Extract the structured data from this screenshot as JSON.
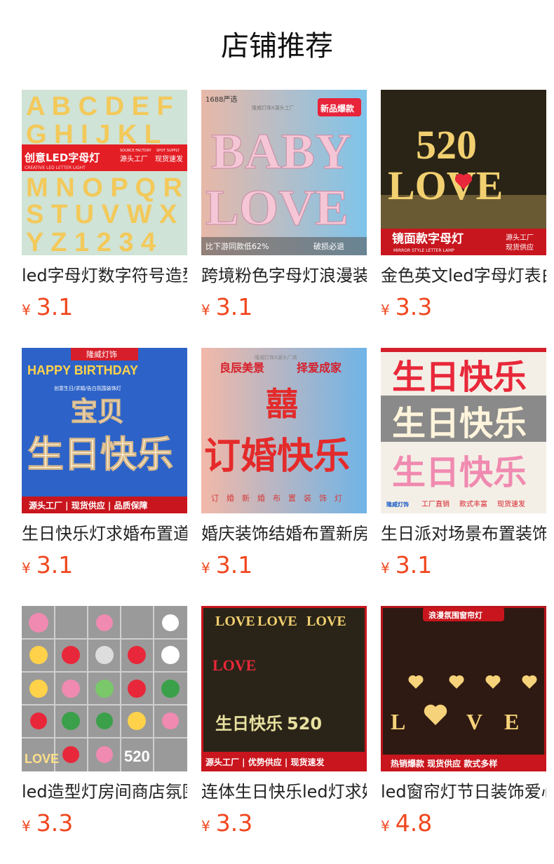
{
  "page_title": "店铺推荐",
  "currency_symbol": "¥",
  "colors": {
    "price": "#f0471f"
  },
  "products": [
    {
      "name": "led字母灯数字符号造型灯",
      "price": "3.1",
      "image_text": [
        "创意LED字母灯",
        "SOURCE FACTORY",
        "SPOT SUPPLY",
        "源头工厂",
        "现货速发",
        "CREATIVE LED LETTER LIGHT"
      ]
    },
    {
      "name": "跨境粉色字母灯浪漫装饰",
      "price": "3.1",
      "image_text": [
        "1688严选",
        "隆威灯饰X源头工厂",
        "新品爆款",
        "BABY",
        "LOVE",
        "比下游同款低62%",
        "破损必退"
      ]
    },
    {
      "name": "金色英文led字母灯表白",
      "price": "3.3",
      "image_text": [
        "520",
        "LOVE",
        "镜面款字母灯",
        "MIRROR STYLE LETTER LAMP",
        "源头工厂",
        "现货供应"
      ]
    },
    {
      "name": "生日快乐灯求婚布置道具",
      "price": "3.1",
      "image_text": [
        "隆威灯饰",
        "HAPPY BIRTHDAY",
        "创意生日/求婚/告白氛围装饰灯",
        "宝贝",
        "生日快乐",
        "源头工厂 | 现货供应 | 品质保障"
      ]
    },
    {
      "name": "婚庆装饰结婚布置新房",
      "price": "3.1",
      "image_text": [
        "隆威灯饰X源头厂商",
        "良辰美景",
        "择爱成家",
        "囍",
        "订婚快乐",
        "订婚新婚布置装饰灯"
      ]
    },
    {
      "name": "生日派对场景布置装饰",
      "price": "3.1",
      "image_text": [
        "生日快乐",
        "生日快乐",
        "生日快乐",
        "隆威灯饰",
        "工厂直销",
        "款式丰富",
        "现货速发"
      ]
    },
    {
      "name": "led造型灯房间商店氛围灯",
      "price": "3.3",
      "image_text": [
        "LOVE",
        "520"
      ]
    },
    {
      "name": "连体生日快乐led灯求婚",
      "price": "3.3",
      "image_text": [
        "LOVE",
        "LOVE",
        "LOVE",
        "LOVE",
        "生日快乐",
        "520",
        "源头工厂 | 优势供应 | 现货速发"
      ]
    },
    {
      "name": "led窗帘灯节日装饰爱心",
      "price": "4.8",
      "image_text": [
        "浪漫氛围窗帘灯",
        "L",
        "V",
        "E",
        "热销爆款 现货供应 款式多样"
      ]
    }
  ]
}
